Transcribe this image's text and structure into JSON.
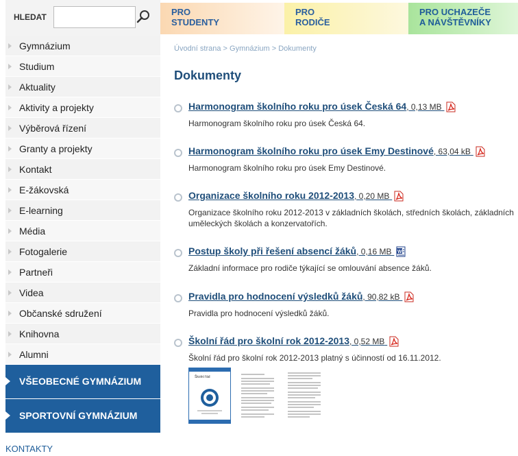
{
  "search": {
    "label": "HLEDAT",
    "value": "",
    "placeholder": ""
  },
  "tabs": [
    {
      "label_line1": "PRO",
      "label_line2": "STUDENTY"
    },
    {
      "label_line1": "PRO",
      "label_line2": "RODIČE"
    },
    {
      "label_line1": "PRO UCHAZEČE",
      "label_line2": "A NÁVŠTĚVNÍKY"
    }
  ],
  "sidebar": {
    "items": [
      {
        "label": "Gymnázium"
      },
      {
        "label": "Studium"
      },
      {
        "label": "Aktuality"
      },
      {
        "label": "Aktivity a projekty"
      },
      {
        "label": "Výběrová řízení"
      },
      {
        "label": "Granty a projekty"
      },
      {
        "label": "Kontakt"
      },
      {
        "label": "E-žákovská"
      },
      {
        "label": "E-learning"
      },
      {
        "label": "Média"
      },
      {
        "label": "Fotogalerie"
      },
      {
        "label": "Partneři"
      },
      {
        "label": "Videa"
      },
      {
        "label": "Občanské sdružení"
      },
      {
        "label": "Knihovna"
      },
      {
        "label": "Alumni"
      }
    ],
    "buttons": [
      {
        "label": "VŠEOBECNÉ GYMNÁZIUM"
      },
      {
        "label": "SPORTOVNÍ GYMNÁZIUM"
      }
    ],
    "contacts": "KONTAKTY"
  },
  "breadcrumb": "Úvodní strana > Gymnázium > Dokumenty",
  "page_title": "Dokumenty",
  "documents": [
    {
      "title": "Harmonogram školního roku pro úsek Česká 64",
      "size": ", 0,13 MB",
      "type": "pdf",
      "description": "Harmonogram školního roku pro úsek Česká 64."
    },
    {
      "title": "Harmonogram školního roku pro úsek Emy Destinové",
      "size": ", 63,04 kB",
      "type": "pdf",
      "description": "Harmonogram školního roku pro úsek Emy Destinové."
    },
    {
      "title": "Organizace školního roku 2012-2013",
      "size": ", 0,20 MB",
      "type": "pdf",
      "description": "Organizace školního roku 2012-2013 v základních školách, středních školách, základních uměleckých školách a konzervatořích."
    },
    {
      "title": "Postup školy při řešení absencí žáků",
      "size": ", 0,16 MB",
      "type": "doc",
      "description": "Základní informace pro rodiče týkající se omlouvání absence žáků."
    },
    {
      "title": "Pravidla pro hodnocení výsledků žáků",
      "size": ", 90,82 kB",
      "type": "pdf",
      "description": "Pravidla pro hodnocení výsledků žáků."
    },
    {
      "title": "Školní řád pro školní rok 2012-2013",
      "size": ", 0,52 MB",
      "type": "pdf",
      "description": "Školní řád pro školní rok 2012-2013 platný s účinností od 16.11.2012."
    }
  ],
  "thumbnail_cover_title": "Školní řád",
  "colors": {
    "accent_blue": "#1f5f9d",
    "link_blue": "#1f4e7a",
    "pdf_red": "#d9271c"
  }
}
